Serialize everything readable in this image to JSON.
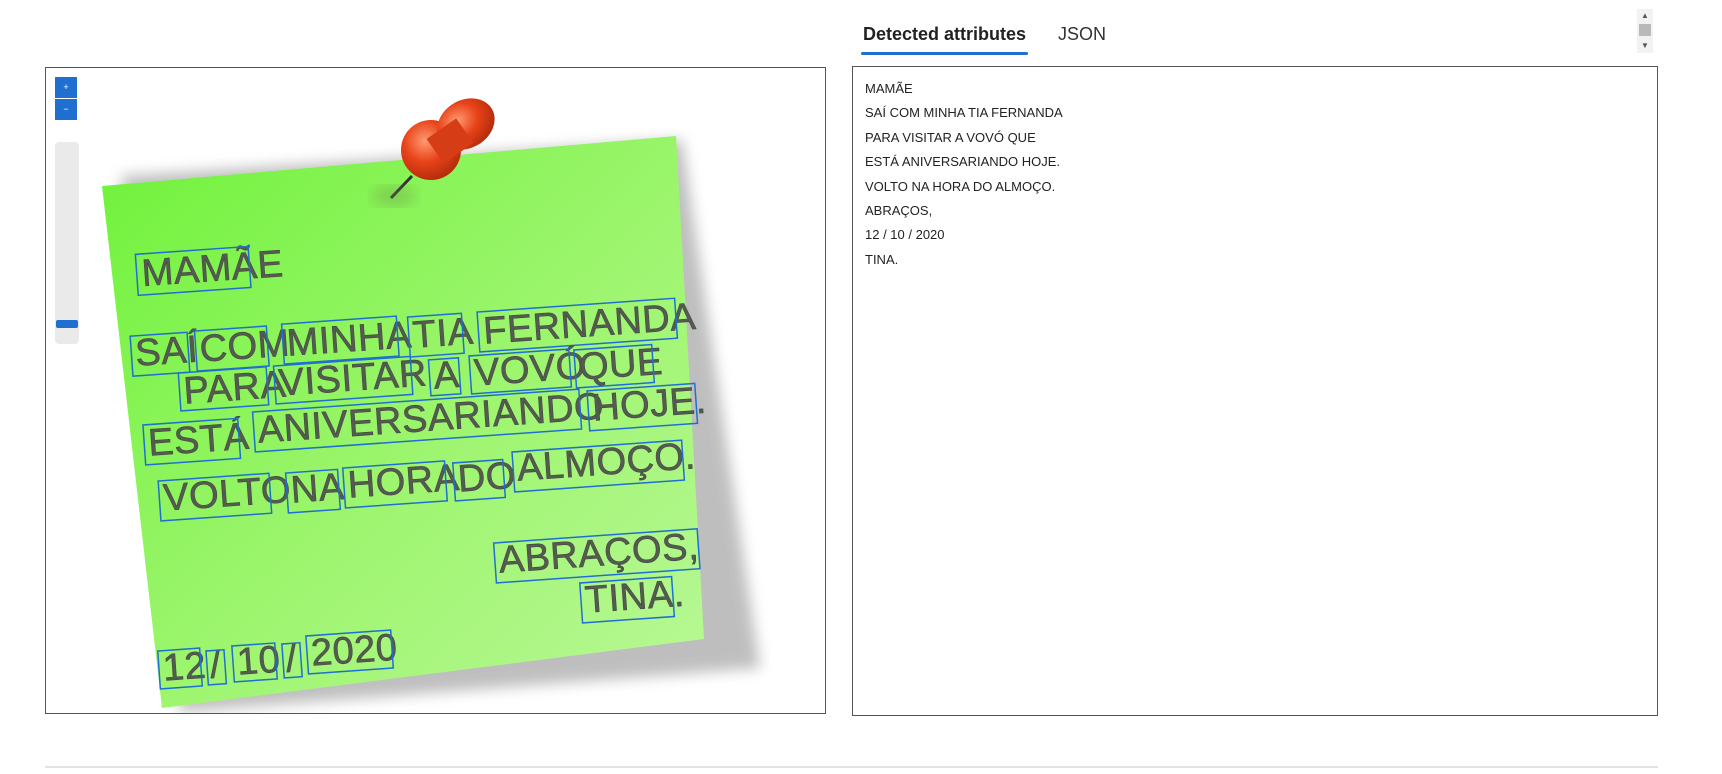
{
  "viewer": {
    "zoom_in": "+",
    "zoom_out": "−",
    "words": [
      {
        "text": "MAMÃE"
      },
      {
        "text": "SAÍ"
      },
      {
        "text": "COM"
      },
      {
        "text": "MINHA"
      },
      {
        "text": "TIA"
      },
      {
        "text": "FERNANDA"
      },
      {
        "text": "PARA"
      },
      {
        "text": "VISITAR"
      },
      {
        "text": "A"
      },
      {
        "text": "VOVÓ"
      },
      {
        "text": "QUE"
      },
      {
        "text": "ESTÁ"
      },
      {
        "text": "ANIVERSARIANDO"
      },
      {
        "text": "HOJE."
      },
      {
        "text": "VOLTO"
      },
      {
        "text": "NA"
      },
      {
        "text": "HORA"
      },
      {
        "text": "DO"
      },
      {
        "text": "ALMOÇO."
      },
      {
        "text": "ABRAÇOS,"
      },
      {
        "text": "TINA."
      },
      {
        "text": "12"
      },
      {
        "text": "/"
      },
      {
        "text": "10"
      },
      {
        "text": "/"
      },
      {
        "text": "2020"
      }
    ]
  },
  "tabs": [
    {
      "label": "Detected attributes",
      "active": true
    },
    {
      "label": "JSON",
      "active": false
    }
  ],
  "result_lines": [
    "MAMÃE",
    "SAÍ COM MINHA TIA FERNANDA",
    "PARA VISITAR A VOVÓ QUE",
    "ESTÁ ANIVERSARIANDO HOJE.",
    "VOLTO NA HORA DO ALMOÇO.",
    "ABRAÇOS,",
    "12 / 10 / 2020",
    "TINA."
  ],
  "colors": {
    "accent": "#1f6fd1",
    "note_light": "#b4f78c",
    "note_dark": "#6ff23a",
    "pin": "#e8431a"
  }
}
